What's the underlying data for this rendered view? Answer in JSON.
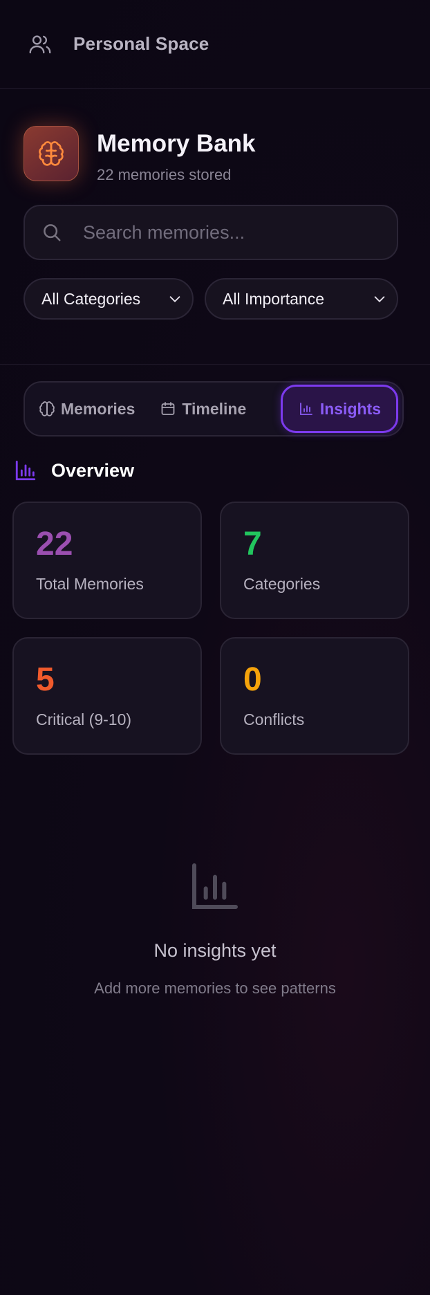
{
  "header": {
    "icon": "users-icon",
    "title": "Personal Space"
  },
  "bank": {
    "icon": "brain-icon",
    "title": "Memory Bank",
    "subtitle": "22 memories stored"
  },
  "search": {
    "icon": "search-icon",
    "placeholder": "Search memories...",
    "value": ""
  },
  "filters": {
    "category": {
      "selected": "All Categories",
      "icon": "chevron-down-icon"
    },
    "importance": {
      "selected": "All Importance",
      "icon": "chevron-down-icon"
    }
  },
  "tabs": [
    {
      "label": "Memories",
      "icon": "brain-icon",
      "active": false
    },
    {
      "label": "Timeline",
      "icon": "calendar-icon",
      "active": false
    },
    {
      "label": "Insights",
      "icon": "bar-chart-icon",
      "active": true
    }
  ],
  "overview": {
    "icon": "bar-chart-icon",
    "title": "Overview",
    "stats": [
      {
        "value": "22",
        "label": "Total Memories",
        "color": "#9b4fb0"
      },
      {
        "value": "7",
        "label": "Categories",
        "color": "#22c55e"
      },
      {
        "value": "5",
        "label": "Critical (9-10)",
        "color": "#f05a2c"
      },
      {
        "value": "0",
        "label": "Conflicts",
        "color": "#f5a30b"
      }
    ]
  },
  "empty_state": {
    "icon": "bar-chart-icon",
    "title": "No insights yet",
    "subtitle": "Add more memories to see patterns"
  },
  "colors": {
    "background": "#0e0816",
    "accent": "#7c3aed",
    "brain_accent": "#ff8a3d"
  }
}
